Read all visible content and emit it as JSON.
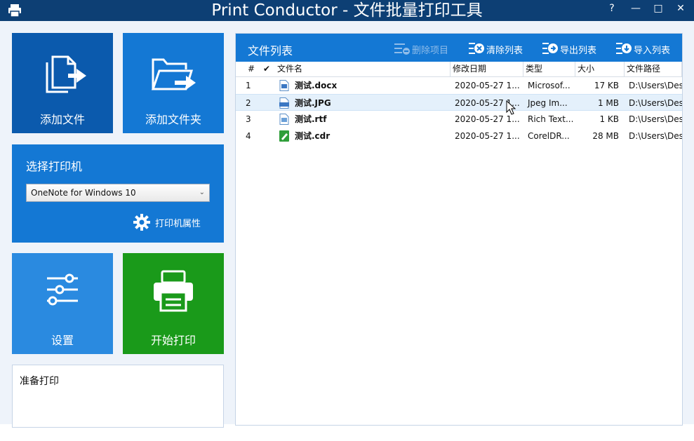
{
  "window": {
    "title": "Print Conductor - 文件批量打印工具",
    "help_glyph": "?",
    "minimize_glyph": "—",
    "maximize_glyph": "□",
    "close_glyph": "✕"
  },
  "tiles": {
    "add_files": "添加文件",
    "add_folder": "添加文件夹",
    "settings": "设置",
    "start_print": "开始打印"
  },
  "printer": {
    "title": "选择打印机",
    "selected": "OneNote for Windows 10",
    "properties": "打印机属性"
  },
  "status": {
    "text": "准备打印"
  },
  "file_list": {
    "title": "文件列表",
    "toolbar": {
      "delete_item": "删除项目",
      "clear_list": "清除列表",
      "export_list": "导出列表",
      "import_list": "导入列表"
    },
    "columns": {
      "num": "#",
      "check": "✔",
      "name": "文件名",
      "date": "修改日期",
      "type": "类型",
      "size": "大小",
      "path": "文件路径"
    },
    "rows": [
      {
        "num": "1",
        "icon": "word-doc-icon",
        "name": "测试.docx",
        "date": "2020-05-27 1...",
        "type": "Microsof...",
        "size": "17 KB",
        "path": "D:\\Users\\Des"
      },
      {
        "num": "2",
        "icon": "jpg-image-icon",
        "name": "测试.JPG",
        "date": "2020-05-27 1...",
        "type": "Jpeg Im...",
        "size": "1 MB",
        "path": "D:\\Users\\Des",
        "selected": true
      },
      {
        "num": "3",
        "icon": "rtf-doc-icon",
        "name": "测试.rtf",
        "date": "2020-05-27 1...",
        "type": "Rich Text...",
        "size": "1 KB",
        "path": "D:\\Users\\Des"
      },
      {
        "num": "4",
        "icon": "coreldraw-icon",
        "name": "测试.cdr",
        "date": "2020-05-27 1...",
        "type": "CorelDR...",
        "size": "28 MB",
        "path": "D:\\Users\\Des"
      }
    ]
  },
  "colors": {
    "titlebar": "#0d3f74",
    "tile_dark_blue": "#0b5aad",
    "tile_blue": "#1478d4",
    "tile_light_blue": "#2a8ae0",
    "tile_green": "#1a9a1a",
    "panel_header": "#1478d4",
    "selected_row": "#e4f0fb"
  }
}
